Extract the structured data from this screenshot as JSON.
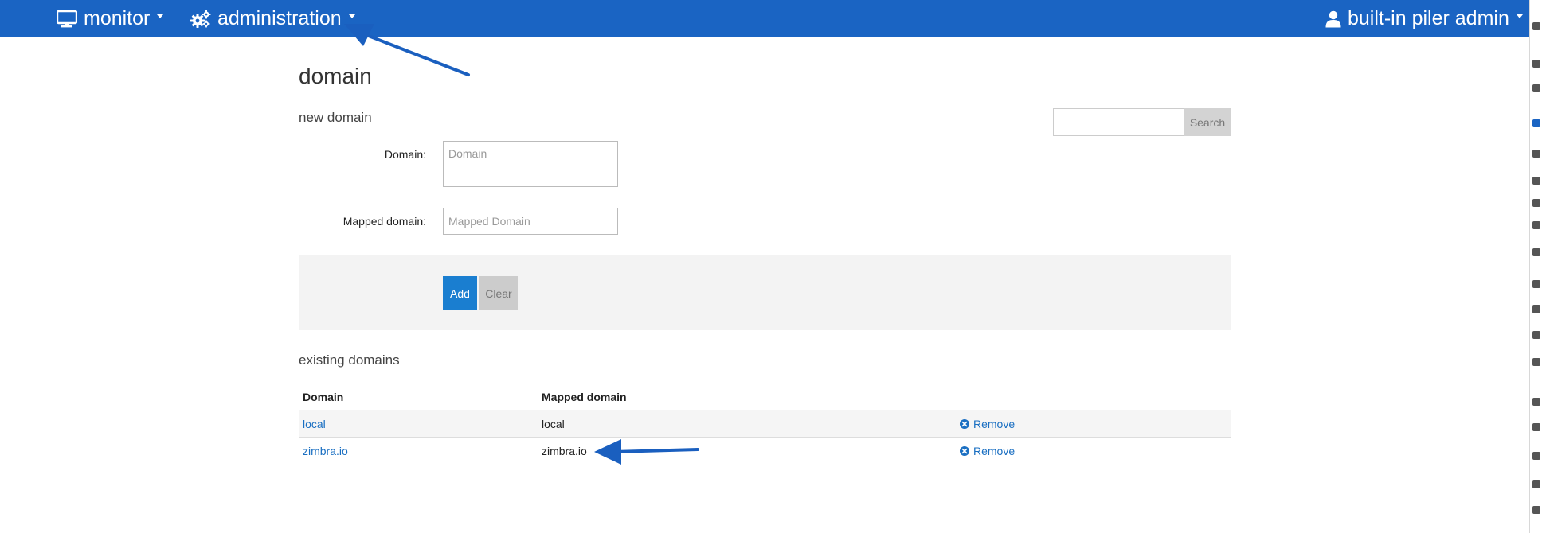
{
  "navbar": {
    "monitor_label": "monitor",
    "administration_label": "administration",
    "user_label": "built-in piler admin"
  },
  "page": {
    "title": "domain"
  },
  "new_domain": {
    "section_title": "new domain",
    "domain_label": "Domain:",
    "domain_placeholder": "Domain",
    "mapped_label": "Mapped domain:",
    "mapped_placeholder": "Mapped Domain",
    "add_label": "Add",
    "clear_label": "Clear"
  },
  "search": {
    "value": "",
    "button_label": "Search"
  },
  "existing": {
    "section_title": "existing domains",
    "columns": [
      "Domain",
      "Mapped domain"
    ],
    "rows": [
      {
        "domain": "local",
        "mapped": "local",
        "action": "Remove"
      },
      {
        "domain": "zimbra.io",
        "mapped": "zimbra.io",
        "action": "Remove"
      }
    ]
  },
  "colors": {
    "navbar": "#1a64c3",
    "primary_button": "#1a7ed0",
    "link": "#1a6fc2",
    "annotation_arrow": "#1a5fbf"
  },
  "icons": {
    "monitor": "monitor-icon",
    "administration": "gears-icon",
    "user": "user-icon",
    "remove": "circle-x-icon",
    "dropdown": "caret-down-icon"
  }
}
